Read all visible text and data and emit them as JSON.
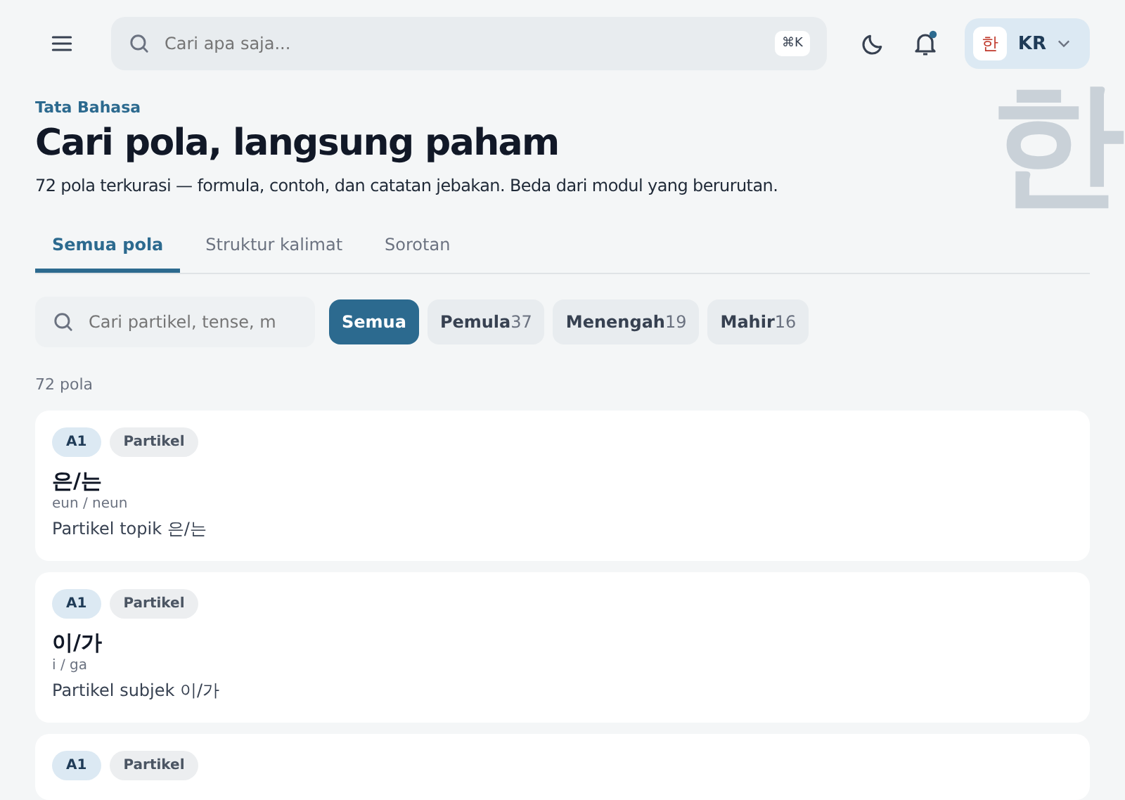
{
  "topbar": {
    "search": {
      "placeholder": "Cari apa saja...",
      "shortcut": "⌘K"
    },
    "notifications": {
      "unread": true
    },
    "language": {
      "glyph": "한",
      "code": "KR"
    }
  },
  "hero": {
    "eyebrow": "Tata Bahasa",
    "title": "Cari pola, langsung paham",
    "subtitle": "72 pola terkurasi — formula, contoh, dan catatan jebakan. Beda dari modul yang berurutan.",
    "decor_glyph": "한"
  },
  "tabs": [
    {
      "label": "Semua pola",
      "selected": true
    },
    {
      "label": "Struktur kalimat",
      "selected": false
    },
    {
      "label": "Sorotan",
      "selected": false
    }
  ],
  "filter": {
    "search": {
      "placeholder": "Cari partikel, tense, m"
    },
    "chips": [
      {
        "label": "Semua",
        "selected": true
      },
      {
        "label": "Pemula",
        "count": "37",
        "selected": false
      },
      {
        "label": "Menengah",
        "count": "19",
        "selected": false
      },
      {
        "label": "Mahir",
        "count": "16",
        "selected": false
      }
    ]
  },
  "result_count": "72 pola",
  "patterns": [
    {
      "level": "A1",
      "category": "Partikel",
      "pattern": "은/는",
      "romanization": "eun / neun",
      "meaning": "Partikel topik 은/는"
    },
    {
      "level": "A1",
      "category": "Partikel",
      "pattern": "이/가",
      "romanization": "i / ga",
      "meaning": "Partikel subjek 이/가"
    },
    {
      "level": "A1",
      "category": "Partikel"
    }
  ]
}
